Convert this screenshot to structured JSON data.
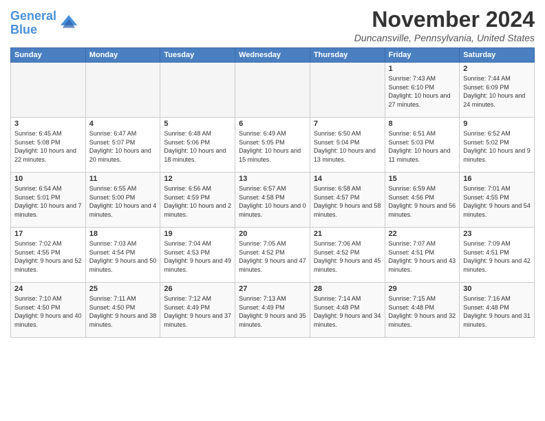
{
  "logo": {
    "line1": "General",
    "line2": "Blue"
  },
  "title": "November 2024",
  "location": "Duncansville, Pennsylvania, United States",
  "days_of_week": [
    "Sunday",
    "Monday",
    "Tuesday",
    "Wednesday",
    "Thursday",
    "Friday",
    "Saturday"
  ],
  "weeks": [
    [
      {
        "day": "",
        "info": ""
      },
      {
        "day": "",
        "info": ""
      },
      {
        "day": "",
        "info": ""
      },
      {
        "day": "",
        "info": ""
      },
      {
        "day": "",
        "info": ""
      },
      {
        "day": "1",
        "info": "Sunrise: 7:43 AM\nSunset: 6:10 PM\nDaylight: 10 hours and 27 minutes."
      },
      {
        "day": "2",
        "info": "Sunrise: 7:44 AM\nSunset: 6:09 PM\nDaylight: 10 hours and 24 minutes."
      }
    ],
    [
      {
        "day": "3",
        "info": "Sunrise: 6:45 AM\nSunset: 5:08 PM\nDaylight: 10 hours and 22 minutes."
      },
      {
        "day": "4",
        "info": "Sunrise: 6:47 AM\nSunset: 5:07 PM\nDaylight: 10 hours and 20 minutes."
      },
      {
        "day": "5",
        "info": "Sunrise: 6:48 AM\nSunset: 5:06 PM\nDaylight: 10 hours and 18 minutes."
      },
      {
        "day": "6",
        "info": "Sunrise: 6:49 AM\nSunset: 5:05 PM\nDaylight: 10 hours and 15 minutes."
      },
      {
        "day": "7",
        "info": "Sunrise: 6:50 AM\nSunset: 5:04 PM\nDaylight: 10 hours and 13 minutes."
      },
      {
        "day": "8",
        "info": "Sunrise: 6:51 AM\nSunset: 5:03 PM\nDaylight: 10 hours and 11 minutes."
      },
      {
        "day": "9",
        "info": "Sunrise: 6:52 AM\nSunset: 5:02 PM\nDaylight: 10 hours and 9 minutes."
      }
    ],
    [
      {
        "day": "10",
        "info": "Sunrise: 6:54 AM\nSunset: 5:01 PM\nDaylight: 10 hours and 7 minutes."
      },
      {
        "day": "11",
        "info": "Sunrise: 6:55 AM\nSunset: 5:00 PM\nDaylight: 10 hours and 4 minutes."
      },
      {
        "day": "12",
        "info": "Sunrise: 6:56 AM\nSunset: 4:59 PM\nDaylight: 10 hours and 2 minutes."
      },
      {
        "day": "13",
        "info": "Sunrise: 6:57 AM\nSunset: 4:58 PM\nDaylight: 10 hours and 0 minutes."
      },
      {
        "day": "14",
        "info": "Sunrise: 6:58 AM\nSunset: 4:57 PM\nDaylight: 9 hours and 58 minutes."
      },
      {
        "day": "15",
        "info": "Sunrise: 6:59 AM\nSunset: 4:56 PM\nDaylight: 9 hours and 56 minutes."
      },
      {
        "day": "16",
        "info": "Sunrise: 7:01 AM\nSunset: 4:55 PM\nDaylight: 9 hours and 54 minutes."
      }
    ],
    [
      {
        "day": "17",
        "info": "Sunrise: 7:02 AM\nSunset: 4:55 PM\nDaylight: 9 hours and 52 minutes."
      },
      {
        "day": "18",
        "info": "Sunrise: 7:03 AM\nSunset: 4:54 PM\nDaylight: 9 hours and 50 minutes."
      },
      {
        "day": "19",
        "info": "Sunrise: 7:04 AM\nSunset: 4:53 PM\nDaylight: 9 hours and 49 minutes."
      },
      {
        "day": "20",
        "info": "Sunrise: 7:05 AM\nSunset: 4:52 PM\nDaylight: 9 hours and 47 minutes."
      },
      {
        "day": "21",
        "info": "Sunrise: 7:06 AM\nSunset: 4:52 PM\nDaylight: 9 hours and 45 minutes."
      },
      {
        "day": "22",
        "info": "Sunrise: 7:07 AM\nSunset: 4:51 PM\nDaylight: 9 hours and 43 minutes."
      },
      {
        "day": "23",
        "info": "Sunrise: 7:09 AM\nSunset: 4:51 PM\nDaylight: 9 hours and 42 minutes."
      }
    ],
    [
      {
        "day": "24",
        "info": "Sunrise: 7:10 AM\nSunset: 4:50 PM\nDaylight: 9 hours and 40 minutes."
      },
      {
        "day": "25",
        "info": "Sunrise: 7:11 AM\nSunset: 4:50 PM\nDaylight: 9 hours and 38 minutes."
      },
      {
        "day": "26",
        "info": "Sunrise: 7:12 AM\nSunset: 4:49 PM\nDaylight: 9 hours and 37 minutes."
      },
      {
        "day": "27",
        "info": "Sunrise: 7:13 AM\nSunset: 4:49 PM\nDaylight: 9 hours and 35 minutes."
      },
      {
        "day": "28",
        "info": "Sunrise: 7:14 AM\nSunset: 4:48 PM\nDaylight: 9 hours and 34 minutes."
      },
      {
        "day": "29",
        "info": "Sunrise: 7:15 AM\nSunset: 4:48 PM\nDaylight: 9 hours and 32 minutes."
      },
      {
        "day": "30",
        "info": "Sunrise: 7:16 AM\nSunset: 4:48 PM\nDaylight: 9 hours and 31 minutes."
      }
    ]
  ]
}
